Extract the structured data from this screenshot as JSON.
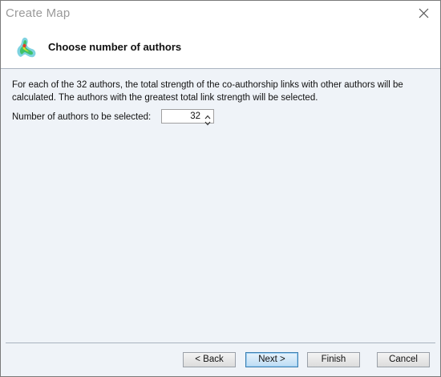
{
  "window": {
    "title": "Create Map"
  },
  "header": {
    "title": "Choose number of authors",
    "icon": "vosviewer-density-map-icon"
  },
  "content": {
    "description": "For each of the 32 authors, the total strength of the co-authorship links with other authors will be calculated. The authors with the greatest total link strength will be selected.",
    "number_label": "Number of authors to be selected:",
    "number_value": "32"
  },
  "buttons": {
    "back": "< Back",
    "next": "Next >",
    "finish": "Finish",
    "cancel": "Cancel"
  }
}
